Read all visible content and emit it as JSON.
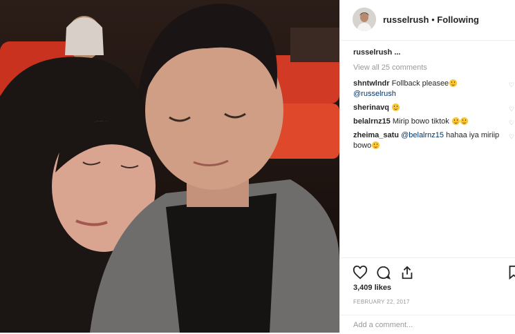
{
  "post": {
    "image_alt": "Selfie of a couple in a cinema"
  },
  "header": {
    "username": "russelrush",
    "separator": "•",
    "follow_status": "Following"
  },
  "caption": {
    "username": "russelrush",
    "text": "..."
  },
  "view_all_comments": "View all 25 comments",
  "comments": [
    {
      "user": "shntwlndr",
      "text": "Follback pleasee",
      "mention": "@russelrush",
      "emoji": "smile"
    },
    {
      "user": "sherinavq",
      "text": "",
      "mention": "",
      "emoji": "smile"
    },
    {
      "user": "belalrnz15",
      "text": "Mirip bowo tiktok",
      "mention": "",
      "emoji": "laugh"
    },
    {
      "user": "zheima_satu",
      "mention": "@belalrnz15",
      "text": "hahaa iya miriip bowo",
      "emoji": "laugh"
    }
  ],
  "actions": {
    "likes": "3,409 likes",
    "date": "FEBRUARY 22, 2017"
  },
  "add_comment": {
    "placeholder": "Add a comment..."
  },
  "icons": [
    "heart-icon",
    "comment-icon",
    "share-icon",
    "bookmark-icon"
  ]
}
